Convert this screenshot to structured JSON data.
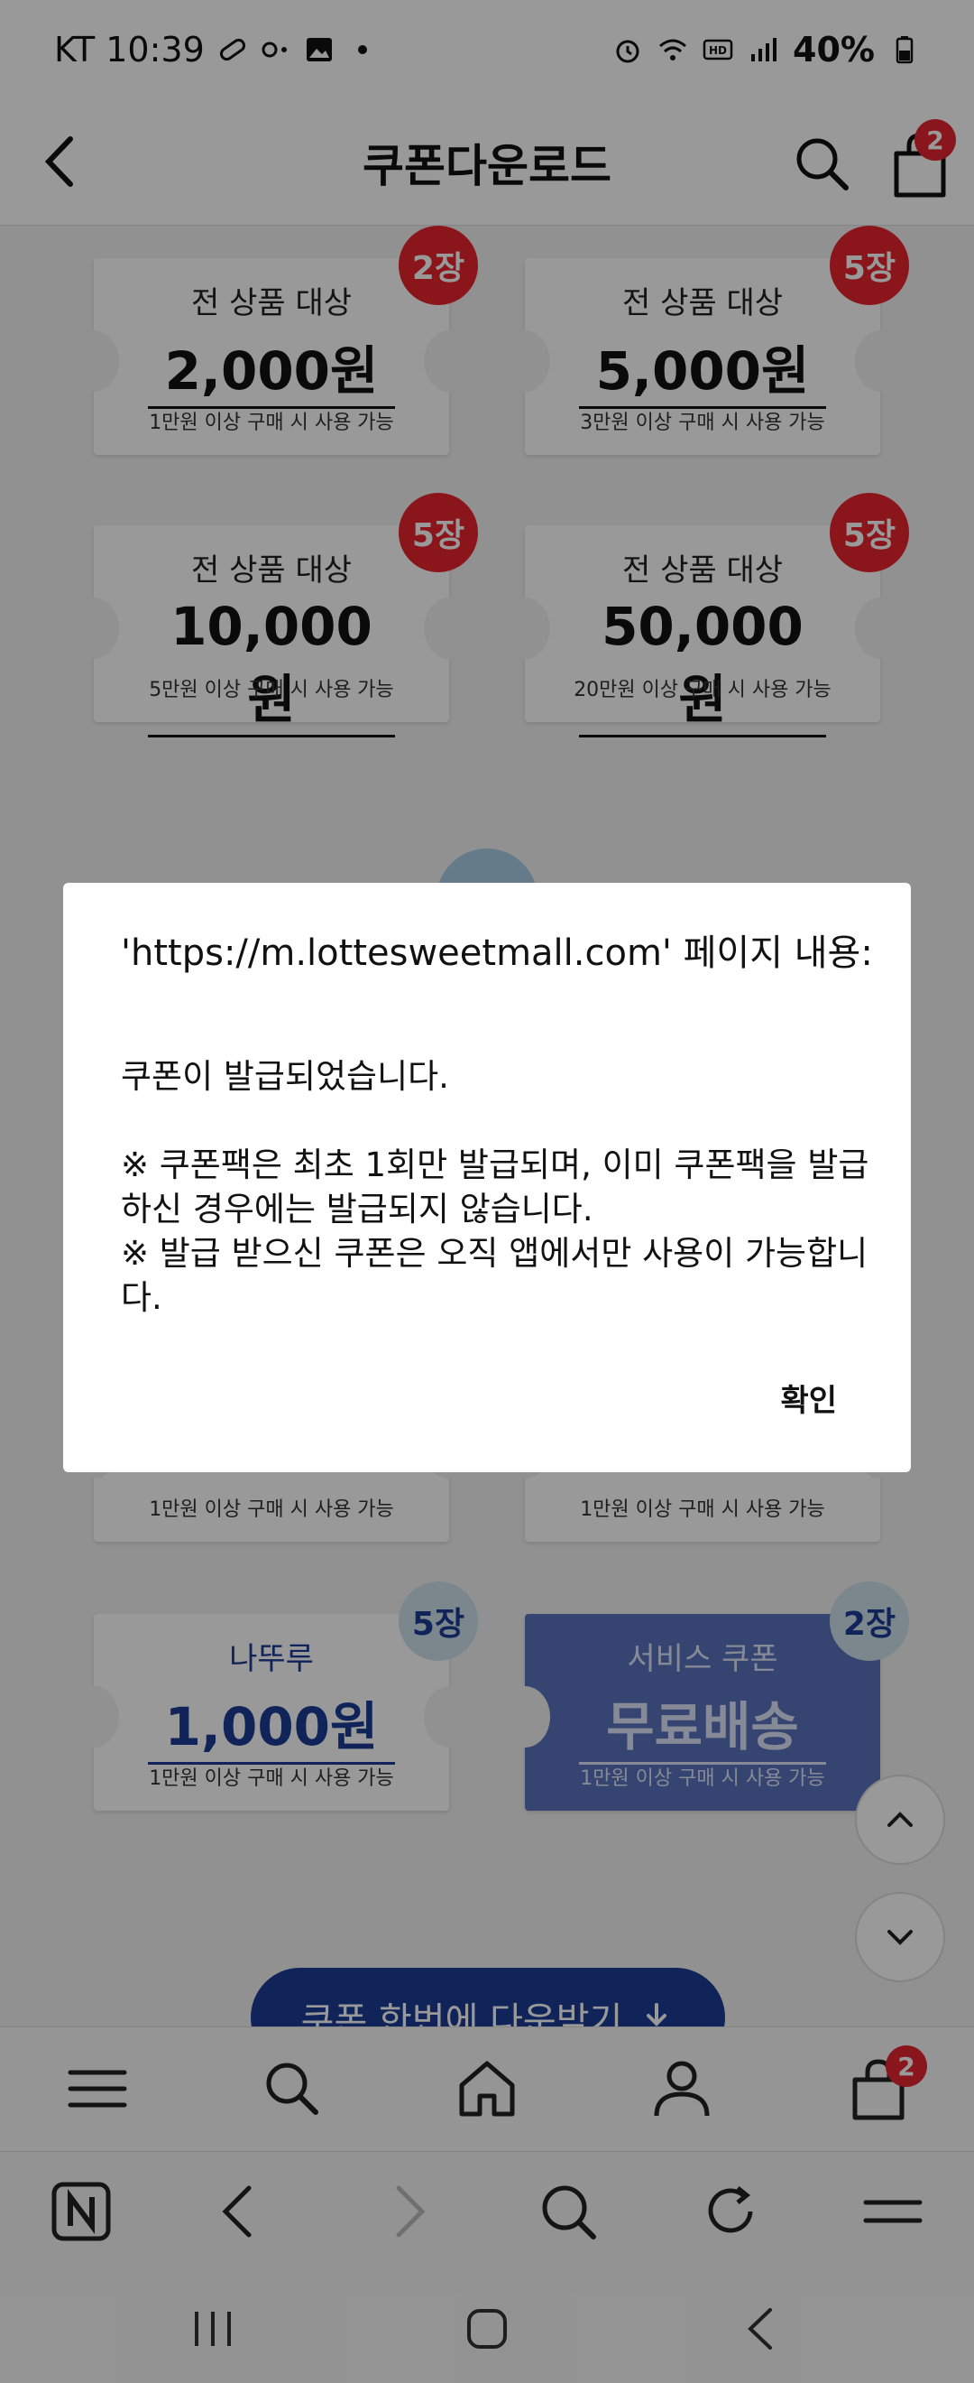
{
  "status_bar": {
    "carrier_time": "KT 10:39",
    "battery": "40%",
    "icons": [
      "pill-icon",
      "link-icon",
      "image-icon",
      "dot-icon",
      "alarm-icon",
      "wifi-icon",
      "hd-icon",
      "signal-icon",
      "battery-icon"
    ]
  },
  "header": {
    "title": "쿠폰다운로드",
    "cart_count": "2"
  },
  "coupons": [
    {
      "title": "전 상품 대상",
      "amount": "2,000원",
      "condition": "1만원 이상 구매 시 사용 가능",
      "count": "2장"
    },
    {
      "title": "전 상품 대상",
      "amount": "5,000원",
      "condition": "3만원 이상 구매 시 사용 가능",
      "count": "5장"
    },
    {
      "title": "전 상품 대상",
      "amount": "10,000원",
      "condition": "5만원 이상 구매 시 사용 가능",
      "count": "5장"
    },
    {
      "title": "전 상품 대상",
      "amount": "50,000원",
      "condition": "20만원 이상 구매 시 사용 가능",
      "count": "5장"
    },
    {
      "condition": "1만원 이상 구매 시 사용 가능"
    },
    {
      "condition": "1만원 이상 구매 시 사용 가능"
    },
    {
      "title": "나뚜루",
      "amount": "1,000원",
      "condition": "1만원 이상 구매 시 사용 가능",
      "count": "5장"
    },
    {
      "title": "서비스 쿠폰",
      "amount": "무료배송",
      "condition": "1만원 이상 구매 시 사용 가능",
      "count": "2장"
    }
  ],
  "download_all": {
    "label": "쿠폰 한번에 다운받기"
  },
  "bottom_nav": {
    "cart_count": "2"
  },
  "dialog": {
    "title": "'https://m.lottesweetmall.com' 페이지 내용:",
    "message": "쿠폰이 발급되었습니다.\n\n※ 쿠폰팩은 최초 1회만 발급되며, 이미 쿠폰팩을 발급하신 경우에는 발급되지 않습니다.\n※ 발급 받으신 쿠폰은 오직 앱에서만 사용이 가능합니다.",
    "confirm_label": "확인"
  }
}
